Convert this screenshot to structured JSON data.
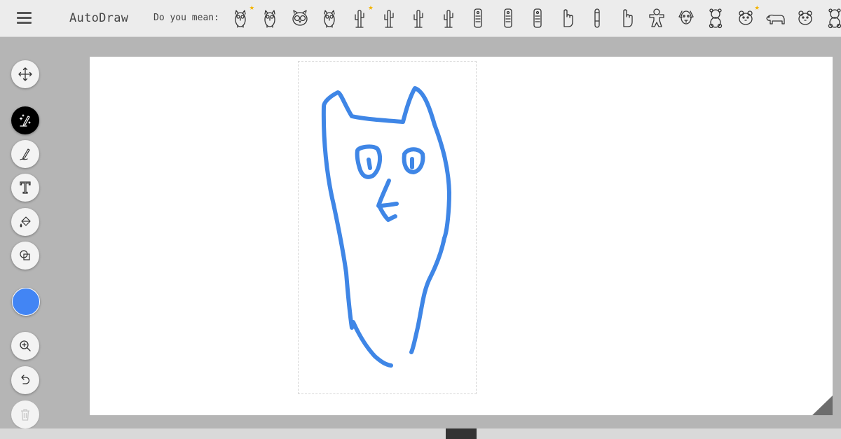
{
  "app": {
    "title": "AutoDraw"
  },
  "suggestions": {
    "label": "Do you mean:",
    "items": [
      {
        "icon": "owl-icon",
        "starred": true
      },
      {
        "icon": "owl-icon",
        "starred": false
      },
      {
        "icon": "owl-face-icon",
        "starred": false
      },
      {
        "icon": "owl-icon",
        "starred": false
      },
      {
        "icon": "cactus-icon",
        "starred": true
      },
      {
        "icon": "cactus-icon",
        "starred": false
      },
      {
        "icon": "cactus-icon",
        "starred": false
      },
      {
        "icon": "cactus-icon",
        "starred": false
      },
      {
        "icon": "remote-control-icon",
        "starred": false
      },
      {
        "icon": "remote-control-icon",
        "starred": false
      },
      {
        "icon": "remote-control-icon",
        "starred": false
      },
      {
        "icon": "pointing-hand-icon",
        "starred": false
      },
      {
        "icon": "finger-icon",
        "starred": false
      },
      {
        "icon": "pointing-hand-icon",
        "starred": false
      },
      {
        "icon": "gingerbread-man-icon",
        "starred": false
      },
      {
        "icon": "dog-icon",
        "starred": false
      },
      {
        "icon": "teddy-bear-icon",
        "starred": false
      },
      {
        "icon": "bear-face-icon",
        "starred": true
      },
      {
        "icon": "polar-bear-icon",
        "starred": false
      },
      {
        "icon": "bear-face-icon",
        "starred": false
      },
      {
        "icon": "teddy-bear-icon",
        "starred": false
      }
    ]
  },
  "tools": [
    {
      "name": "move-tool",
      "icon": "move-icon"
    },
    {
      "name": "autodraw-tool",
      "icon": "magic-pencil-icon"
    },
    {
      "name": "draw-tool",
      "icon": "pencil-icon"
    },
    {
      "name": "type-tool",
      "icon": "text-icon"
    },
    {
      "name": "fill-tool",
      "icon": "paint-bucket-icon"
    },
    {
      "name": "shape-tool",
      "icon": "shapes-icon"
    },
    {
      "name": "zoom-tool",
      "icon": "zoom-in-icon"
    },
    {
      "name": "undo-tool",
      "icon": "undo-icon"
    },
    {
      "name": "delete-tool",
      "icon": "trash-icon"
    }
  ],
  "colors": {
    "current": "#4285f4",
    "stroke": "#3f86e6",
    "accent": "#f4b400"
  }
}
